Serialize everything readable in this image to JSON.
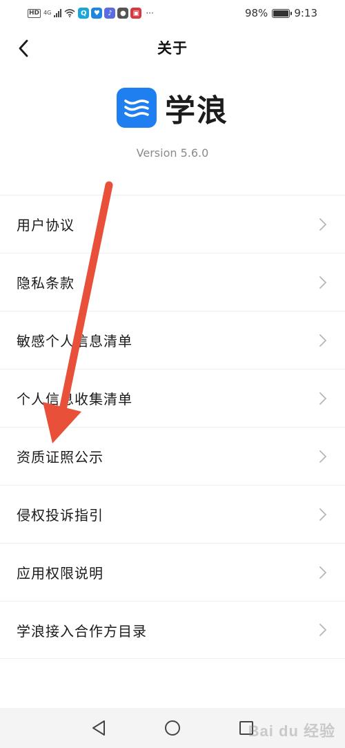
{
  "status_bar": {
    "hd_badge": "HD",
    "network": "4G",
    "battery_text": "98%",
    "battery_level": 0.98,
    "time": "9:13",
    "overflow": "···",
    "app_icons": [
      {
        "name": "search-app-icon",
        "color": "#1aa6d9",
        "glyph": "Q"
      },
      {
        "name": "bulb-app-icon",
        "color": "#1f86e0",
        "glyph": "♥"
      },
      {
        "name": "music-app-icon",
        "color": "#5b6be0",
        "glyph": "♪"
      },
      {
        "name": "chat-app-icon",
        "color": "#555555",
        "glyph": "●"
      },
      {
        "name": "book-app-icon",
        "color": "#d9363e",
        "glyph": "▣"
      }
    ]
  },
  "nav": {
    "title": "关于"
  },
  "app": {
    "name": "学浪",
    "version": "Version 5.6.0",
    "brand_color": "#1f7ff0"
  },
  "menu": {
    "items": [
      {
        "label": "用户协议"
      },
      {
        "label": "隐私条款"
      },
      {
        "label": "敏感个人信息清单"
      },
      {
        "label": "个人信息收集清单"
      },
      {
        "label": "资质证照公示"
      },
      {
        "label": "侵权投诉指引"
      },
      {
        "label": "应用权限说明"
      },
      {
        "label": "学浪接入合作方目录"
      }
    ]
  },
  "annotation": {
    "arrow_color": "#e8503a"
  },
  "watermark": "Bai du 经验"
}
